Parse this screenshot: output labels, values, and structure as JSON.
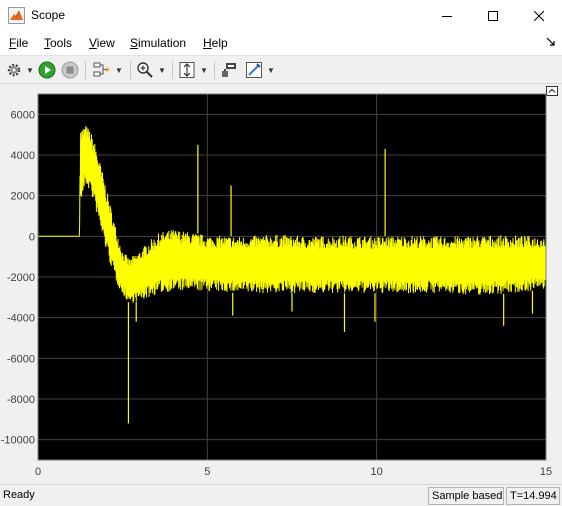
{
  "window": {
    "title": "Scope",
    "app_icon": "matlab-scope-icon",
    "controls": [
      "minimize-icon",
      "maximize-icon",
      "close-icon"
    ]
  },
  "menu": {
    "items": [
      {
        "label": "File",
        "mnemonic": "F",
        "rest": "ile"
      },
      {
        "label": "Tools",
        "mnemonic": "T",
        "rest": "ools"
      },
      {
        "label": "View",
        "mnemonic": "V",
        "rest": "iew"
      },
      {
        "label": "Simulation",
        "mnemonic": "S",
        "rest": "imulation"
      },
      {
        "label": "Help",
        "mnemonic": "H",
        "rest": "elp"
      }
    ],
    "dock_icon": "dock-arrow-icon"
  },
  "toolbar": {
    "buttons": [
      "settings-gear-icon",
      "run-icon",
      "stop-icon",
      "signal-selector-icon",
      "zoom-in-icon",
      "scale-axes-icon",
      "style-icon",
      "cursor-measurements-icon"
    ]
  },
  "colors": {
    "plot_background": "#000000",
    "signal": "#ffff00",
    "axes_frame": "#f0f0f0",
    "grid": "#424242",
    "tick_label": "#404040"
  },
  "chart_data": {
    "type": "line",
    "title": "",
    "xlabel": "",
    "ylabel": "",
    "xlim": [
      0,
      15
    ],
    "ylim": [
      -11000,
      7000
    ],
    "x_ticks": [
      0,
      5,
      10,
      15
    ],
    "x_tick_labels": [
      "0",
      "5",
      "10",
      "15"
    ],
    "y_ticks": [
      6000,
      4000,
      2000,
      0,
      -2000,
      -4000,
      -6000,
      -8000,
      -10000
    ],
    "y_tick_labels": [
      "6000",
      "4000",
      "2000",
      "0",
      "-2000",
      "-4000",
      "-6000",
      "-8000",
      "-10000"
    ],
    "grid": true,
    "legend": "none",
    "series": [
      {
        "color": "#ffff00",
        "upper_envelope": {
          "x": [
            0,
            1.22,
            1.25,
            1.4,
            1.55,
            1.7,
            1.9,
            2.1,
            2.3,
            2.5,
            2.7,
            3.0,
            3.3,
            3.6,
            4.0,
            4.5,
            5.0,
            6.0,
            7.0,
            8.0,
            9.0,
            10.0,
            11.0,
            12.0,
            13.0,
            14.0,
            15.0
          ],
          "y": [
            0,
            0,
            5300,
            5500,
            5200,
            4500,
            3200,
            1800,
            400,
            -700,
            -1100,
            -700,
            -200,
            200,
            350,
            200,
            50,
            0,
            100,
            0,
            50,
            0,
            50,
            0,
            50,
            50,
            0
          ]
        },
        "lower_envelope": {
          "x": [
            0,
            1.22,
            1.25,
            1.4,
            1.55,
            1.7,
            1.9,
            2.1,
            2.3,
            2.5,
            2.7,
            3.0,
            3.3,
            3.6,
            4.0,
            4.5,
            5.0,
            6.0,
            7.0,
            8.0,
            9.0,
            10.0,
            11.0,
            12.0,
            13.0,
            14.0,
            15.0
          ],
          "y": [
            0,
            0,
            1500,
            2500,
            2200,
            1300,
            0,
            -1200,
            -2200,
            -2900,
            -3300,
            -3200,
            -3000,
            -2800,
            -2700,
            -2700,
            -2700,
            -2800,
            -2800,
            -2800,
            -2800,
            -2800,
            -2800,
            -2800,
            -2900,
            -2800,
            -2600
          ]
        },
        "spikes": [
          {
            "x": 2.67,
            "y": -9200
          },
          {
            "x": 2.9,
            "y": -4200
          },
          {
            "x": 4.72,
            "y": 4500
          },
          {
            "x": 5.7,
            "y": 2500
          },
          {
            "x": 5.75,
            "y": -3900
          },
          {
            "x": 7.5,
            "y": -3700
          },
          {
            "x": 9.05,
            "y": -4700
          },
          {
            "x": 9.95,
            "y": -4200
          },
          {
            "x": 10.25,
            "y": 4300
          },
          {
            "x": 13.75,
            "y": -4400
          },
          {
            "x": 14.6,
            "y": -3800
          }
        ]
      }
    ]
  },
  "status": {
    "state": "Ready",
    "sample_mode": "Sample based",
    "time": "T=14.994"
  }
}
